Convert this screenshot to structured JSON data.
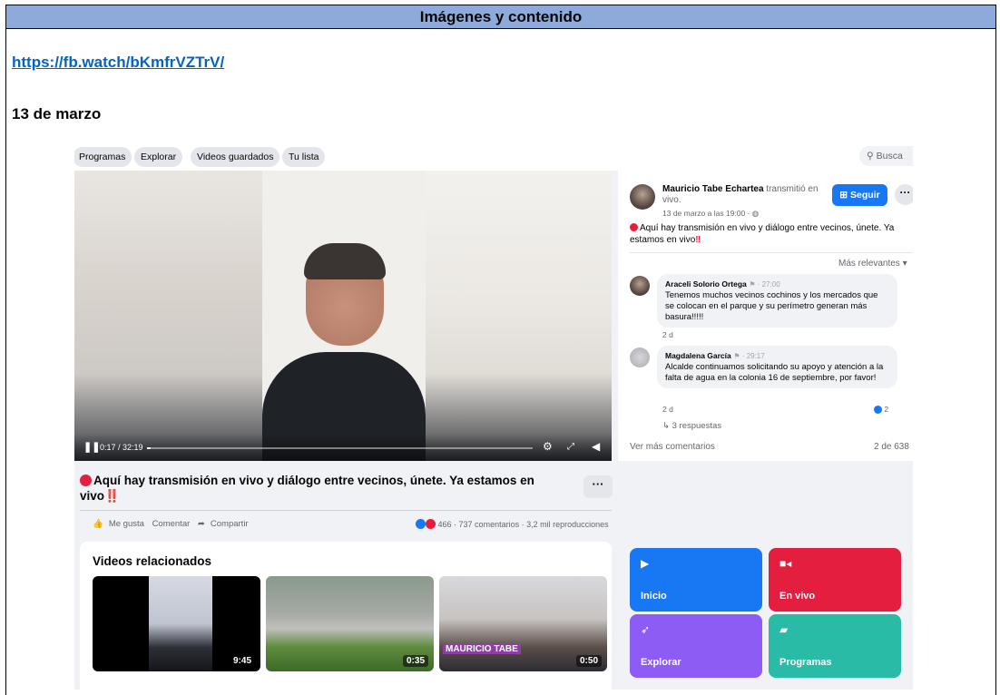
{
  "doc": {
    "header": "Imágenes y contenido",
    "link": "https://fb.watch/bKmfrVZTrV/",
    "date": "13 de marzo"
  },
  "nav": {
    "tabs": [
      "Programas",
      "Explorar",
      "Videos guardados",
      "Tu lista"
    ],
    "search_placeholder": "Busca"
  },
  "player": {
    "time": "0:17 / 32:19",
    "progress_fraction": 0.009
  },
  "post": {
    "title": "Aquí hay transmisión en vivo y diálogo entre vecinos, únete. Ya estamos en vivo‼️",
    "more": "···",
    "actions": {
      "like": "Me gusta",
      "comment": "Comentar",
      "share": "Compartir"
    },
    "reactions": "466",
    "stats": " · 737 comentarios · 3,2 mil reproducciones"
  },
  "sidebar": {
    "author": "Mauricio Tabe Echartea",
    "author_action": " transmitió en vivo.",
    "meta": "13 de marzo a las 19:00 · ",
    "follow": "Seguir",
    "more": "···",
    "post_text": "Aquí hay transmisión en vivo y diálogo entre vecinos, únete. Ya estamos en vivo",
    "sort": "Más relevantes",
    "comments": [
      {
        "name": "Araceli Solorio Ortega",
        "time": " · 27:00",
        "text": "Tenemos muchos vecinos cochinos y los mercados que se colocan en el parque y su perímetro generan más basura!!!!!",
        "age": "2 d"
      },
      {
        "name": "Magdalena García",
        "time": " · 29:17",
        "text": "Alcalde continuamos solicitando su apoyo y atención a la falta de agua en la colonia 16 de septiembre, por favor!",
        "age": "2 d",
        "likes": "2"
      }
    ],
    "replies": "3 respuestas",
    "see_more": "Ver más comentarios",
    "pager": "2 de 638"
  },
  "related": {
    "title": "Videos relacionados",
    "durations": [
      "9:45",
      "0:35",
      "0:50"
    ],
    "thumb3_text": "MAURICIO TABE"
  },
  "tiles": [
    {
      "label": "Inicio",
      "color": "#1877f2"
    },
    {
      "label": "En vivo",
      "color": "#e41e3f"
    },
    {
      "label": "Explorar",
      "color": "#8c5cf5"
    },
    {
      "label": "Programas",
      "color": "#2abba7"
    }
  ]
}
